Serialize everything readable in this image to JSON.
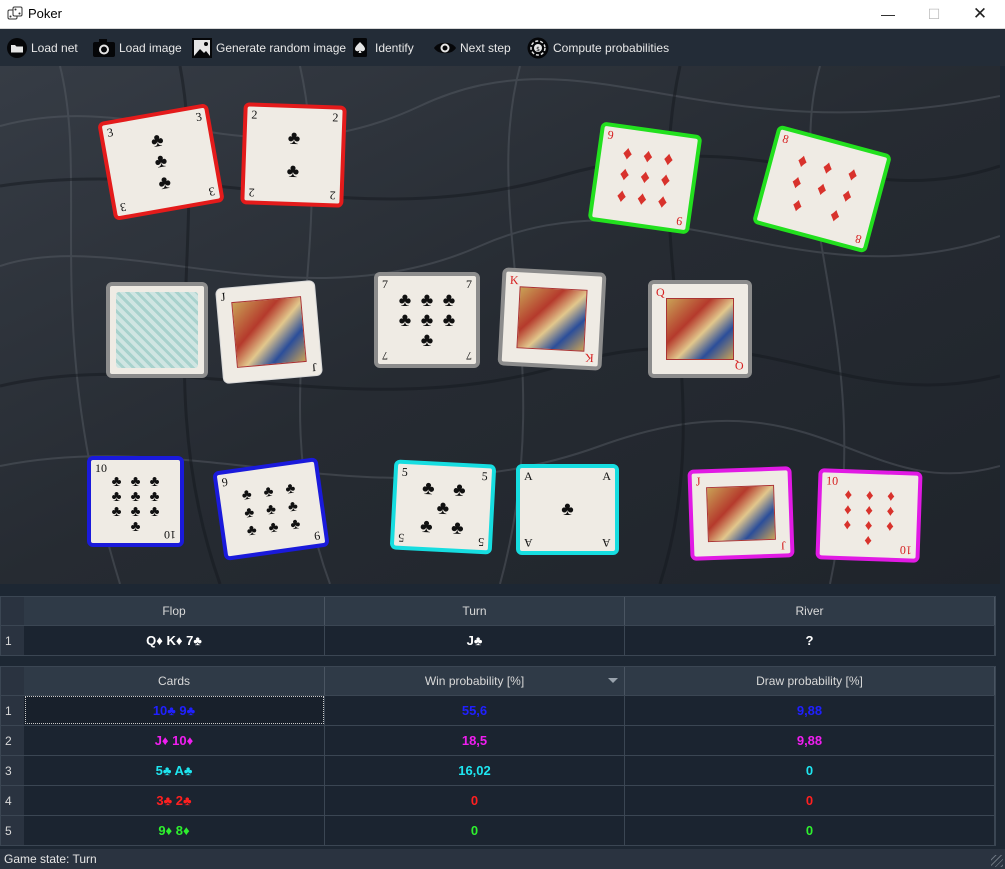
{
  "window": {
    "title": "Poker",
    "controls": {
      "minimize": "—",
      "maximize": "☐",
      "close": "✕"
    }
  },
  "toolbar": {
    "load_net": "Load net",
    "load_image": "Load image",
    "generate_random_image": "Generate random image",
    "identify": "Identify",
    "next_step": "Next step",
    "compute_probabilities": "Compute probabilities"
  },
  "board": {
    "cards": [
      {
        "rank": "3",
        "suit": "♣",
        "pips": [
          "♣",
          "♣",
          "♣"
        ],
        "frame": "red"
      },
      {
        "rank": "2",
        "suit": "♣",
        "pips": [
          "♣",
          "♣"
        ],
        "frame": "red"
      },
      {
        "rank": "9",
        "suit": "♦",
        "pips": [
          "♦",
          "♦",
          "♦",
          "♦",
          "♦",
          "♦",
          "♦",
          "♦",
          "♦"
        ],
        "frame": "green"
      },
      {
        "rank": "8",
        "suit": "♦",
        "pips": [
          "♦",
          "♦",
          "♦",
          "♦",
          "♦",
          "♦",
          "♦",
          "♦"
        ],
        "frame": "green"
      },
      {
        "rank": "",
        "suit": "",
        "pips": [],
        "frame": "grey",
        "face_down": true
      },
      {
        "rank": "J",
        "suit": "♣",
        "pips": [],
        "frame": "none",
        "face": true
      },
      {
        "rank": "7",
        "suit": "♣",
        "pips": [
          "♣",
          "♣",
          "♣",
          "♣",
          "♣",
          "♣",
          "♣"
        ],
        "frame": "grey"
      },
      {
        "rank": "K",
        "suit": "♦",
        "pips": [],
        "frame": "grey",
        "face": true
      },
      {
        "rank": "Q",
        "suit": "♦",
        "pips": [],
        "frame": "grey",
        "face": true
      },
      {
        "rank": "10",
        "suit": "♣",
        "pips": [
          "♣",
          "♣",
          "♣",
          "♣",
          "♣",
          "♣",
          "♣",
          "♣",
          "♣",
          "♣"
        ],
        "frame": "blue"
      },
      {
        "rank": "9",
        "suit": "♣",
        "pips": [
          "♣",
          "♣",
          "♣",
          "♣",
          "♣",
          "♣",
          "♣",
          "♣",
          "♣"
        ],
        "frame": "blue"
      },
      {
        "rank": "5",
        "suit": "♣",
        "pips": [
          "♣",
          "♣",
          "♣",
          "♣",
          "♣"
        ],
        "frame": "cyan"
      },
      {
        "rank": "A",
        "suit": "♣",
        "pips": [
          "♣"
        ],
        "frame": "cyan"
      },
      {
        "rank": "J",
        "suit": "♦",
        "pips": [],
        "frame": "magenta",
        "face": true
      },
      {
        "rank": "10",
        "suit": "♦",
        "pips": [
          "♦",
          "♦",
          "♦",
          "♦",
          "♦",
          "♦",
          "♦",
          "♦",
          "♦",
          "♦"
        ],
        "frame": "magenta"
      }
    ]
  },
  "community_table": {
    "headers": [
      "Flop",
      "Turn",
      "River"
    ],
    "rows": [
      {
        "index": "1",
        "flop": "Q♦ K♦ 7♣",
        "turn": "J♣",
        "river": "?"
      }
    ]
  },
  "players_table": {
    "headers": [
      "Cards",
      "Win probability [%]",
      "Draw probability [%]"
    ],
    "rows": [
      {
        "index": "1",
        "cards": "10♣ 9♣",
        "win": "55,6",
        "draw": "9,88",
        "color": "#2020ff"
      },
      {
        "index": "2",
        "cards": "J♦ 10♦",
        "win": "18,5",
        "draw": "9,88",
        "color": "#f01ef0"
      },
      {
        "index": "3",
        "cards": "5♣ A♣",
        "win": "16,02",
        "draw": "0",
        "color": "#1ee6f0"
      },
      {
        "index": "4",
        "cards": "3♣ 2♣",
        "win": "0",
        "draw": "0",
        "color": "#ff2020"
      },
      {
        "index": "5",
        "cards": "9♦ 8♦",
        "win": "0",
        "draw": "0",
        "color": "#2ef02e"
      }
    ]
  },
  "status": {
    "text": "Game state: Turn"
  }
}
